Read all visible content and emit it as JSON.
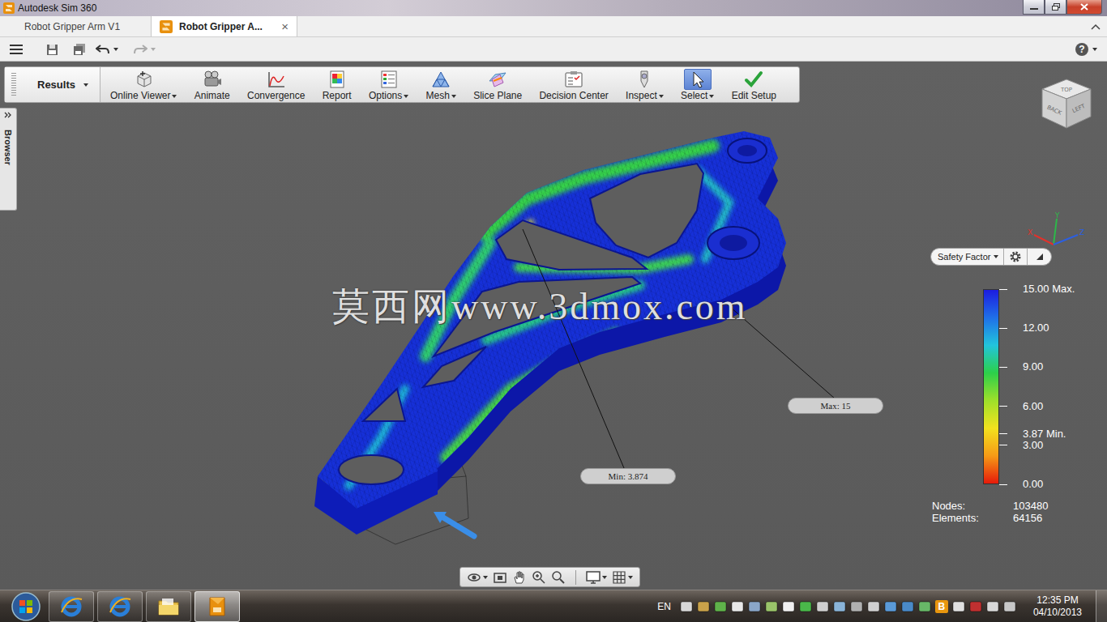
{
  "window": {
    "title": "Autodesk Sim 360"
  },
  "tabs": [
    {
      "label": "Robot Gripper Arm V1",
      "selected": false,
      "closable": false
    },
    {
      "label": "Robot Gripper A...",
      "selected": true,
      "closable": true
    }
  ],
  "tab_close": "×",
  "quick_access": {
    "help": "?",
    "undo_disabled": false,
    "redo_disabled": true
  },
  "ribbon": {
    "mode": "Results",
    "buttons": [
      {
        "label": "Online Viewer",
        "dropdown": true,
        "selected": false
      },
      {
        "label": "Animate",
        "dropdown": false,
        "selected": false
      },
      {
        "label": "Convergence",
        "dropdown": false,
        "selected": false
      },
      {
        "label": "Report",
        "dropdown": false,
        "selected": false
      },
      {
        "label": "Options",
        "dropdown": true,
        "selected": false
      },
      {
        "label": "Mesh",
        "dropdown": true,
        "selected": false
      },
      {
        "label": "Slice Plane",
        "dropdown": false,
        "selected": false
      },
      {
        "label": "Decision Center",
        "dropdown": false,
        "selected": false
      },
      {
        "label": "Inspect",
        "dropdown": true,
        "selected": false
      },
      {
        "label": "Select",
        "dropdown": true,
        "selected": true
      },
      {
        "label": "Edit Setup",
        "dropdown": false,
        "selected": false
      }
    ]
  },
  "browser": {
    "label": "Browser"
  },
  "watermark": "莫西网www.3dmox.com",
  "callouts": [
    {
      "label": "Min: 3.874"
    },
    {
      "label": "Max: 15"
    }
  ],
  "view_cube": {
    "faces": [
      "TOP",
      "BACK",
      "LEFT"
    ]
  },
  "axes": [
    {
      "label": "Y",
      "color": "#2db84a"
    },
    {
      "label": "X",
      "color": "#e0322c"
    },
    {
      "label": "Z",
      "color": "#2c5fe0"
    }
  ],
  "legend": {
    "result": "Safety Factor",
    "max": 15,
    "min": 0,
    "colors": [
      "#1c1ce0",
      "#1f6fe8",
      "#22c4dc",
      "#2cd04a",
      "#9ee02a",
      "#f2e21e",
      "#f59a16",
      "#e61a0a"
    ],
    "ticks": [
      {
        "label": "15.00 Max.",
        "value": 15
      },
      {
        "label": "12.00",
        "value": 12
      },
      {
        "label": "9.00",
        "value": 9
      },
      {
        "label": "6.00",
        "value": 6
      },
      {
        "label": "3.87 Min.",
        "value": 3.87
      },
      {
        "label": "3.00",
        "value": 3
      },
      {
        "label": "0.00",
        "value": 0
      }
    ]
  },
  "stats": [
    {
      "label": "Nodes:",
      "value": "103480"
    },
    {
      "label": "Elements:",
      "value": "64156"
    }
  ],
  "taskbar": {
    "apps": [
      {
        "kind": "ie",
        "selected": false
      },
      {
        "kind": "ie",
        "selected": false
      },
      {
        "kind": "folder",
        "selected": false
      },
      {
        "kind": "sim",
        "selected": true
      }
    ],
    "language": "EN",
    "tray_badge": "B",
    "time": "12:35 PM",
    "date": "04/10/2013"
  }
}
